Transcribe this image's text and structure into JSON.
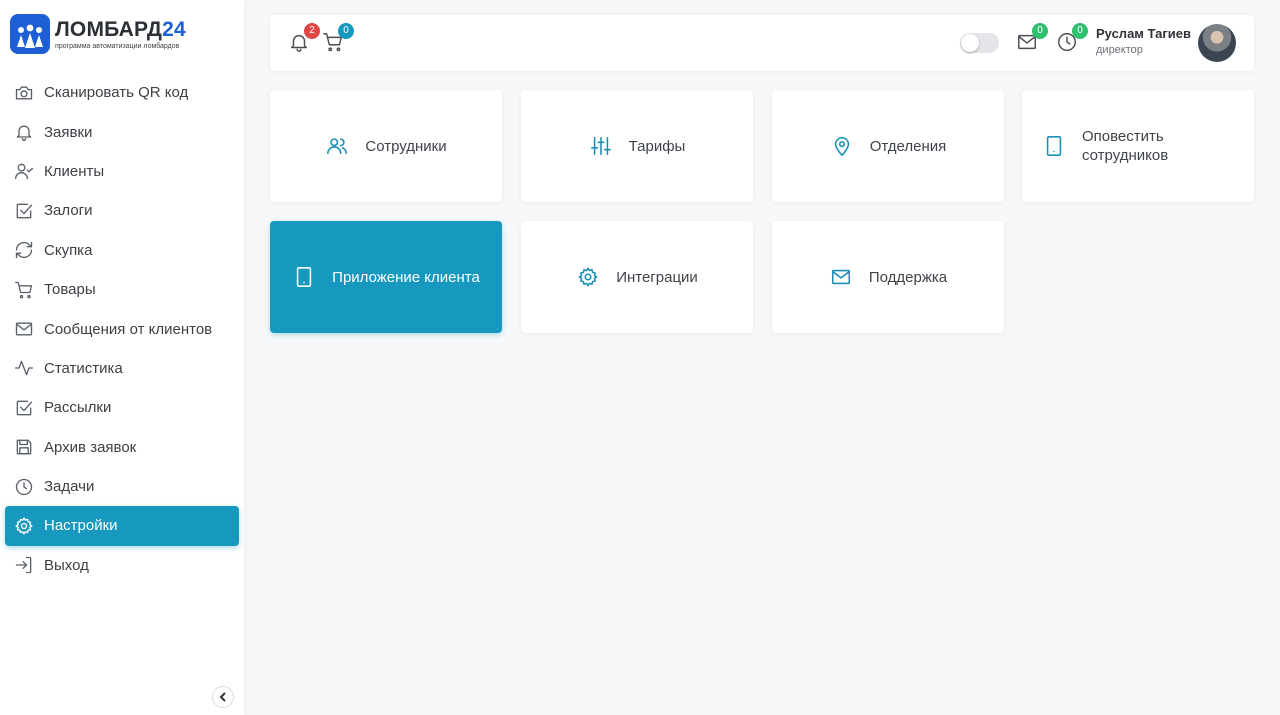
{
  "brand": {
    "title_main": "ЛОМБАРД",
    "title_accent": "24",
    "subtitle": "программа автоматизации ломбардов",
    "color": "#1e5fd6"
  },
  "sidebar": {
    "items": [
      {
        "label": "Сканировать QR код",
        "icon": "camera-icon"
      },
      {
        "label": "Заявки",
        "icon": "bell-icon"
      },
      {
        "label": "Клиенты",
        "icon": "user-check-icon"
      },
      {
        "label": "Залоги",
        "icon": "check-square-icon"
      },
      {
        "label": "Скупка",
        "icon": "refresh-icon"
      },
      {
        "label": "Товары",
        "icon": "cart-icon"
      },
      {
        "label": "Сообщения от клиентов",
        "icon": "mail-icon"
      },
      {
        "label": "Статистика",
        "icon": "activity-icon"
      },
      {
        "label": "Рассылки",
        "icon": "check-square-icon"
      },
      {
        "label": "Архив заявок",
        "icon": "save-icon"
      },
      {
        "label": "Задачи",
        "icon": "clock-icon"
      },
      {
        "label": "Настройки",
        "icon": "gear-icon",
        "active": true
      },
      {
        "label": "Выход",
        "icon": "log-in-icon"
      }
    ],
    "accent_color": "#1698bf"
  },
  "topbar": {
    "notifications_count": "2",
    "cart_count": "0",
    "mail_count": "0",
    "history_count": "0",
    "user_name": "Руслам Тагиев",
    "user_role": "директор",
    "badge_colors": {
      "red": "#e04646",
      "blue": "#1698bf",
      "green": "#2fbf71"
    }
  },
  "tiles": [
    {
      "label": "Сотрудники",
      "icon": "users-icon"
    },
    {
      "label": "Тарифы",
      "icon": "sliders-icon"
    },
    {
      "label": "Отделения",
      "icon": "map-pin-icon"
    },
    {
      "label": "Оповестить сотрудников",
      "icon": "tablet-icon"
    },
    {
      "label": "Приложение клиента",
      "icon": "tablet-icon",
      "active": true
    },
    {
      "label": "Интеграции",
      "icon": "gear-icon"
    },
    {
      "label": "Поддержка",
      "icon": "mail-icon"
    }
  ]
}
